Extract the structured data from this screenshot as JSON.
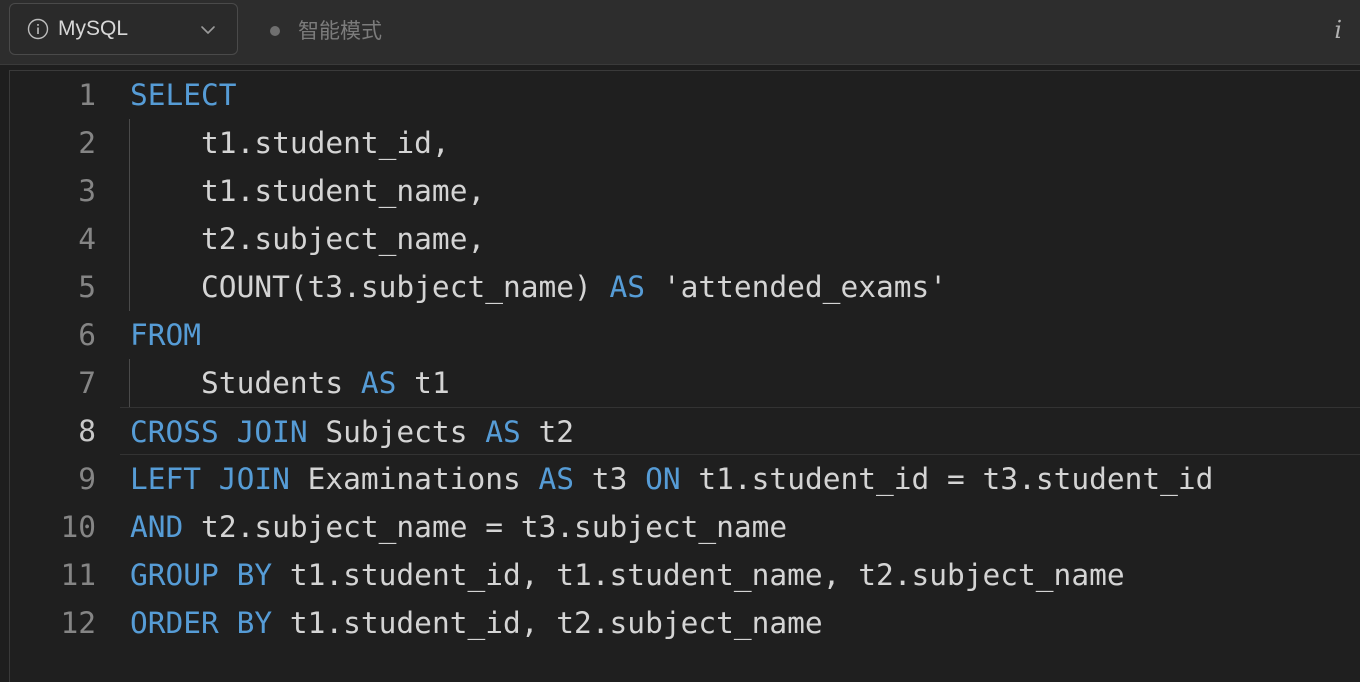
{
  "toolbar": {
    "language": "MySQL",
    "mode_label": "智能模式",
    "info_label": "i"
  },
  "editor": {
    "active_line": 8,
    "lines": [
      {
        "number": "1",
        "tokens": [
          {
            "t": "SELECT",
            "k": 1
          }
        ]
      },
      {
        "number": "2",
        "tokens": [
          {
            "t": "    t1.student_id,",
            "k": 0
          }
        ]
      },
      {
        "number": "3",
        "tokens": [
          {
            "t": "    t1.student_name,",
            "k": 0
          }
        ]
      },
      {
        "number": "4",
        "tokens": [
          {
            "t": "    t2.subject_name,",
            "k": 0
          }
        ]
      },
      {
        "number": "5",
        "tokens": [
          {
            "t": "    COUNT(t3.subject_name) ",
            "k": 0
          },
          {
            "t": "AS",
            "k": 1
          },
          {
            "t": " 'attended_exams'",
            "k": 0
          }
        ]
      },
      {
        "number": "6",
        "tokens": [
          {
            "t": "FROM",
            "k": 1
          }
        ]
      },
      {
        "number": "7",
        "tokens": [
          {
            "t": "    Students ",
            "k": 0
          },
          {
            "t": "AS",
            "k": 1
          },
          {
            "t": " t1",
            "k": 0
          }
        ]
      },
      {
        "number": "8",
        "tokens": [
          {
            "t": "CROSS JOIN",
            "k": 1
          },
          {
            "t": " Subjects ",
            "k": 0
          },
          {
            "t": "AS",
            "k": 1
          },
          {
            "t": " t2",
            "k": 0
          }
        ]
      },
      {
        "number": "9",
        "tokens": [
          {
            "t": "LEFT JOIN",
            "k": 1
          },
          {
            "t": " Examinations ",
            "k": 0
          },
          {
            "t": "AS",
            "k": 1
          },
          {
            "t": " t3 ",
            "k": 0
          },
          {
            "t": "ON",
            "k": 1
          },
          {
            "t": " t1.student_id = t3.student_id",
            "k": 0
          }
        ]
      },
      {
        "number": "10",
        "tokens": [
          {
            "t": "AND",
            "k": 1
          },
          {
            "t": " t2.subject_name = t3.subject_name",
            "k": 0
          }
        ]
      },
      {
        "number": "11",
        "tokens": [
          {
            "t": "GROUP BY",
            "k": 1
          },
          {
            "t": " t1.student_id, t1.student_name, t2.subject_name",
            "k": 0
          }
        ]
      },
      {
        "number": "12",
        "tokens": [
          {
            "t": "ORDER BY",
            "k": 1
          },
          {
            "t": " t1.student_id, t2.subject_name",
            "k": 0
          }
        ]
      }
    ]
  },
  "colors": {
    "keyword": "#569cd6",
    "text": "#d4d4d4",
    "line_number": "#858585",
    "background": "#1f1f1f"
  }
}
